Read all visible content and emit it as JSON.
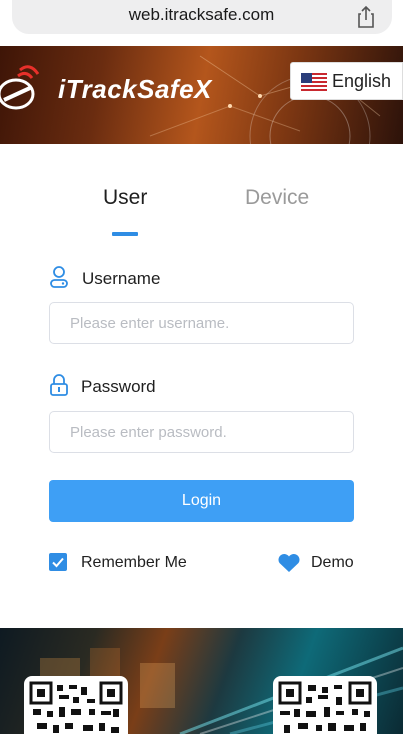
{
  "browser": {
    "url": "web.itracksafe.com"
  },
  "header": {
    "brand": "iTrackSafeX",
    "language": "English"
  },
  "tabs": [
    {
      "label": "User",
      "active": true
    },
    {
      "label": "Device",
      "active": false
    }
  ],
  "form": {
    "username_label": "Username",
    "username_placeholder": "Please enter username.",
    "password_label": "Password",
    "password_placeholder": "Please enter password.",
    "login_label": "Login",
    "remember_label": "Remember Me",
    "remember_checked": true,
    "demo_label": "Demo"
  },
  "colors": {
    "accent": "#2f8de4",
    "button": "#3e9ff5",
    "muted_tab": "#9a9a9a"
  }
}
